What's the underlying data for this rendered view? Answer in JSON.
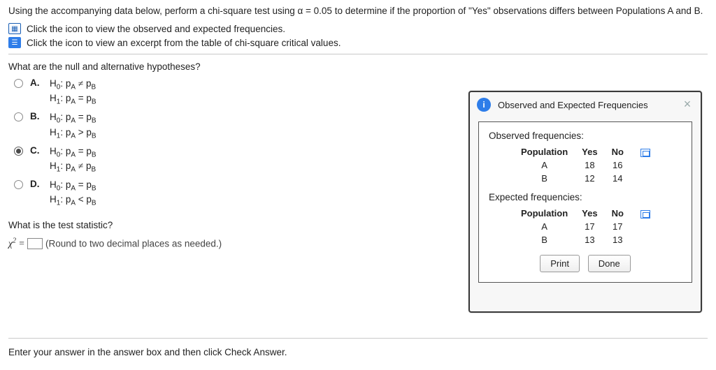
{
  "intro": "Using the accompanying data below, perform a chi-square test using α = 0.05 to determine if the proportion of \"Yes\" observations differs between Populations A and B.",
  "link1": "Click the icon to view the observed and expected frequencies.",
  "link2": "Click the icon to view an excerpt from the table of chi-square critical values.",
  "q1": "What are the null and alternative hypotheses?",
  "choices": {
    "A": {
      "h0": "H₀: p_A ≠ p_B",
      "h1": "H₁: p_A = p_B"
    },
    "B": {
      "h0": "H₀: p_A = p_B",
      "h1": "H₁: p_A > p_B"
    },
    "C": {
      "h0": "H₀: p_A = p_B",
      "h1": "H₁: p_A ≠ p_B"
    },
    "D": {
      "h0": "H₀: p_A = p_B",
      "h1": "H₁: p_A < p_B"
    }
  },
  "selected_choice": "C",
  "q2": "What is the test statistic?",
  "chi_label_before": "χ² =",
  "chi_hint": "(Round to two decimal places as needed.)",
  "footer_text": "Enter your answer in the answer box and then click Check Answer.",
  "modal": {
    "title": "Observed and Expected Frequencies",
    "observed_label": "Observed frequencies:",
    "expected_label": "Expected frequencies:",
    "headers": {
      "pop": "Population",
      "yes": "Yes",
      "no": "No"
    },
    "observed": [
      {
        "pop": "A",
        "yes": "18",
        "no": "16"
      },
      {
        "pop": "B",
        "yes": "12",
        "no": "14"
      }
    ],
    "expected": [
      {
        "pop": "A",
        "yes": "17",
        "no": "17"
      },
      {
        "pop": "B",
        "yes": "13",
        "no": "13"
      }
    ],
    "print": "Print",
    "done": "Done"
  }
}
